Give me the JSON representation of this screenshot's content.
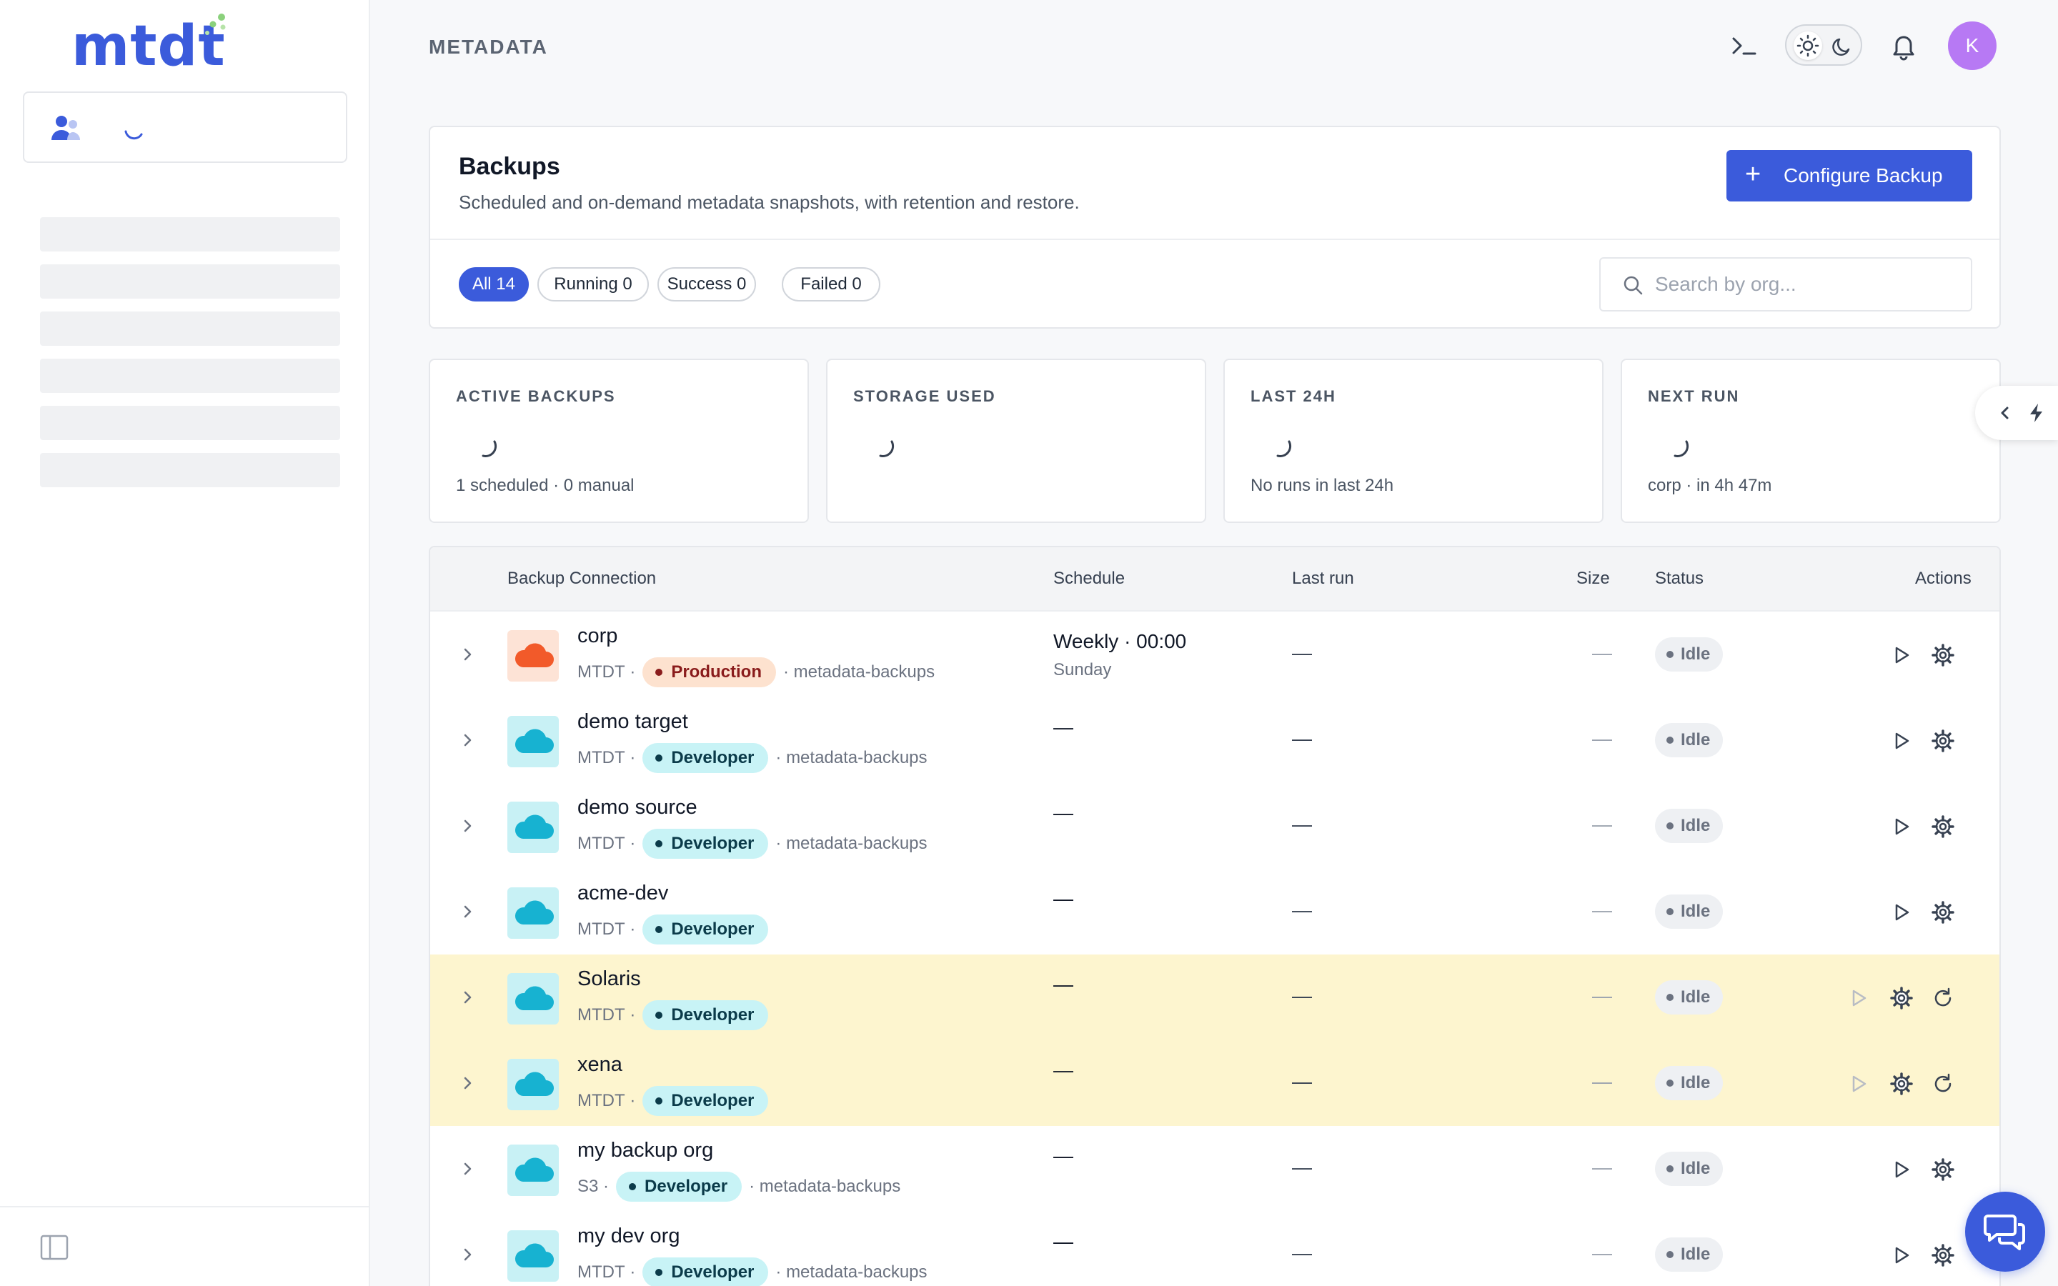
{
  "app": {
    "logo_text": "mtdt"
  },
  "header": {
    "title": "METADATA",
    "avatar_initial": "K"
  },
  "backups": {
    "title": "Backups",
    "subtitle": "Scheduled and on-demand metadata snapshots, with retention and restore.",
    "configure_label": "Configure Backup",
    "filters": [
      "All 14",
      "Running 0",
      "Success 0",
      "Failed 0"
    ],
    "search_placeholder": "Search by org..."
  },
  "stats": [
    {
      "title": "ACTIVE BACKUPS",
      "sub": "1 scheduled · 0 manual"
    },
    {
      "title": "STORAGE USED",
      "sub": ""
    },
    {
      "title": "LAST 24H",
      "sub": "No runs in last 24h"
    },
    {
      "title": "NEXT RUN",
      "sub": "corp · in 4h 47m"
    }
  ],
  "table": {
    "columns": [
      "Backup Connection",
      "Schedule",
      "Last run",
      "Size",
      "Status",
      "Actions"
    ],
    "rows": [
      {
        "name": "corp",
        "source": "MTDT",
        "env": "Production",
        "bucket": "metadata-backups",
        "schedule": "Weekly · 00:00",
        "schedule_day": "Sunday",
        "last_run": "—",
        "size": "—",
        "status": "Idle",
        "highlight": false
      },
      {
        "name": "demo target",
        "source": "MTDT",
        "env": "Developer",
        "bucket": "metadata-backups",
        "schedule": "—",
        "schedule_day": "",
        "last_run": "—",
        "size": "—",
        "status": "Idle",
        "highlight": false
      },
      {
        "name": "demo source",
        "source": "MTDT",
        "env": "Developer",
        "bucket": "metadata-backups",
        "schedule": "—",
        "schedule_day": "",
        "last_run": "—",
        "size": "—",
        "status": "Idle",
        "highlight": false
      },
      {
        "name": "acme-dev",
        "source": "MTDT",
        "env": "Developer",
        "bucket": "",
        "schedule": "—",
        "schedule_day": "",
        "last_run": "—",
        "size": "—",
        "status": "Idle",
        "highlight": false
      },
      {
        "name": "Solaris",
        "source": "MTDT",
        "env": "Developer",
        "bucket": "",
        "schedule": "—",
        "schedule_day": "",
        "last_run": "—",
        "size": "—",
        "status": "Idle",
        "highlight": true
      },
      {
        "name": "xena",
        "source": "MTDT",
        "env": "Developer",
        "bucket": "",
        "schedule": "—",
        "schedule_day": "",
        "last_run": "—",
        "size": "—",
        "status": "Idle",
        "highlight": true
      },
      {
        "name": "my backup org",
        "source": "S3",
        "env": "Developer",
        "bucket": "metadata-backups",
        "schedule": "—",
        "schedule_day": "",
        "last_run": "—",
        "size": "—",
        "status": "Idle",
        "highlight": false
      },
      {
        "name": "my dev org",
        "source": "MTDT",
        "env": "Developer",
        "bucket": "metadata-backups",
        "schedule": "—",
        "schedule_day": "",
        "last_run": "—",
        "size": "—",
        "status": "Idle",
        "highlight": false
      }
    ]
  },
  "colors": {
    "accent": "#3b5bdb",
    "highlight_row": "#fdf5cf",
    "production_cloud": "#f25a2a",
    "developer_cloud": "#17b2d1"
  },
  "icons": [
    "terminal-icon",
    "sun-icon",
    "moon-icon",
    "bell-icon",
    "search-icon",
    "chevron-right-icon",
    "cloud-icon",
    "play-icon",
    "gear-icon",
    "refresh-icon",
    "chevron-left-icon",
    "lightning-icon",
    "chat-icon",
    "sidebar-collapse-icon",
    "users-icon"
  ]
}
